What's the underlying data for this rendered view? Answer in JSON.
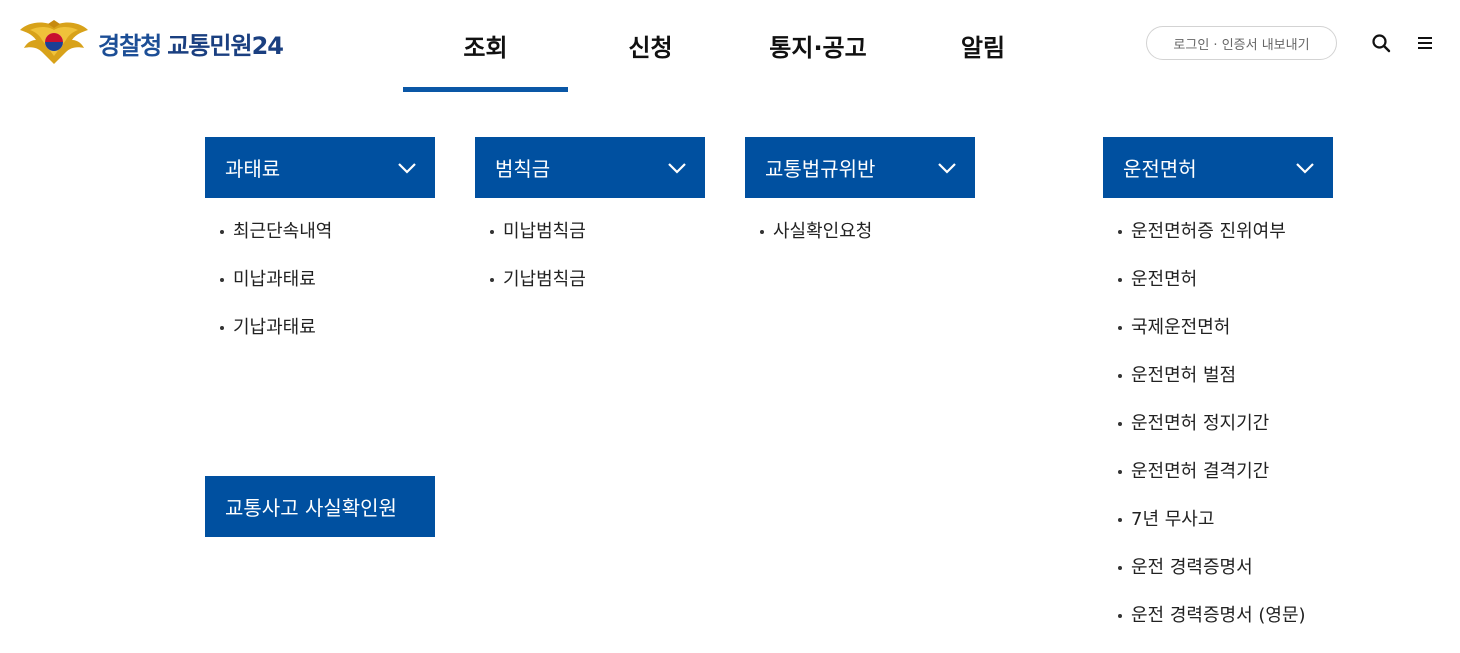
{
  "logo": {
    "org": "경찰청",
    "service": "교통민원24"
  },
  "nav": {
    "items": [
      {
        "label": "조회"
      },
      {
        "label": "신청"
      },
      {
        "label": "통지·공고"
      },
      {
        "label": "알림"
      }
    ],
    "active": "조회"
  },
  "header": {
    "login_label": "로그인 · 인증서 내보내기",
    "search_icon": "search-icon",
    "menu_icon": "hamburger-menu-icon"
  },
  "menu": {
    "columns": [
      {
        "title": "과태료",
        "items": [
          "최근단속내역",
          "미납과태료",
          "기납과태료"
        ]
      },
      {
        "title": "범칙금",
        "items": [
          "미납범칙금",
          "기납범칙금"
        ]
      },
      {
        "title": "교통법규위반",
        "items": [
          "사실확인요청"
        ]
      },
      {
        "title": "운전면허",
        "items": [
          "운전면허증 진위여부",
          "운전면허",
          "국제운전면허",
          "운전면허 벌점",
          "운전면허 정지기간",
          "운전면허 결격기간",
          "7년 무사고",
          "운전 경력증명서",
          "운전 경력증명서 (영문)"
        ]
      }
    ],
    "accident_button": "교통사고 사실확인원"
  },
  "colors": {
    "primary": "#0050a0",
    "nav_underline": "#0a57a6",
    "logo_text": "#1c4e96"
  }
}
